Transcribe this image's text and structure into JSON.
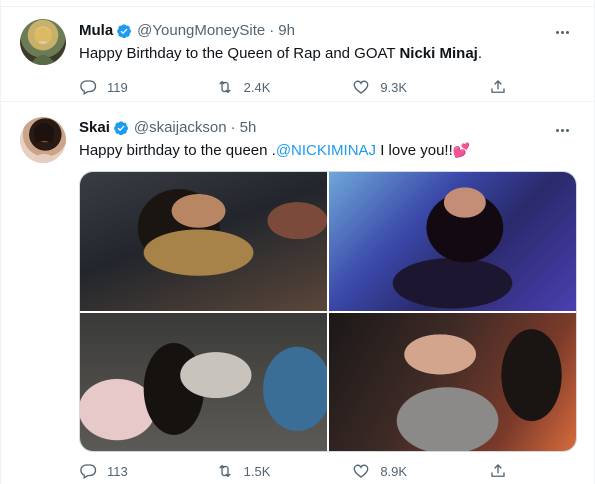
{
  "tweets": [
    {
      "display_name": "Mula",
      "handle": "@YoungMoneySite",
      "separator": "·",
      "time": "9h",
      "text_prefix": "Happy Birthday to the Queen of Rap and GOAT ",
      "text_bold": "Nicki Minaj",
      "text_suffix": ".",
      "replies": "119",
      "retweets": "2.4K",
      "likes": "9.3K"
    },
    {
      "display_name": "Skai",
      "handle": "@skaijackson",
      "separator": "·",
      "time": "5h",
      "text_prefix": "Happy birthday to the queen .",
      "text_mention": "@NICKIMINAJ",
      "text_suffix": " I love you!!",
      "emoji": "💕",
      "replies": "113",
      "retweets": "1.5K",
      "likes": "8.9K"
    }
  ],
  "icons": {
    "verified": "verified-badge-icon",
    "more": "more-icon",
    "reply": "reply-icon",
    "retweet": "retweet-icon",
    "like": "like-icon",
    "share": "share-icon"
  },
  "colors": {
    "accent": "#1d9bf0",
    "text": "#0f1419",
    "muted": "#536471",
    "border": "#eff3f4",
    "heart": "#e0245e"
  }
}
